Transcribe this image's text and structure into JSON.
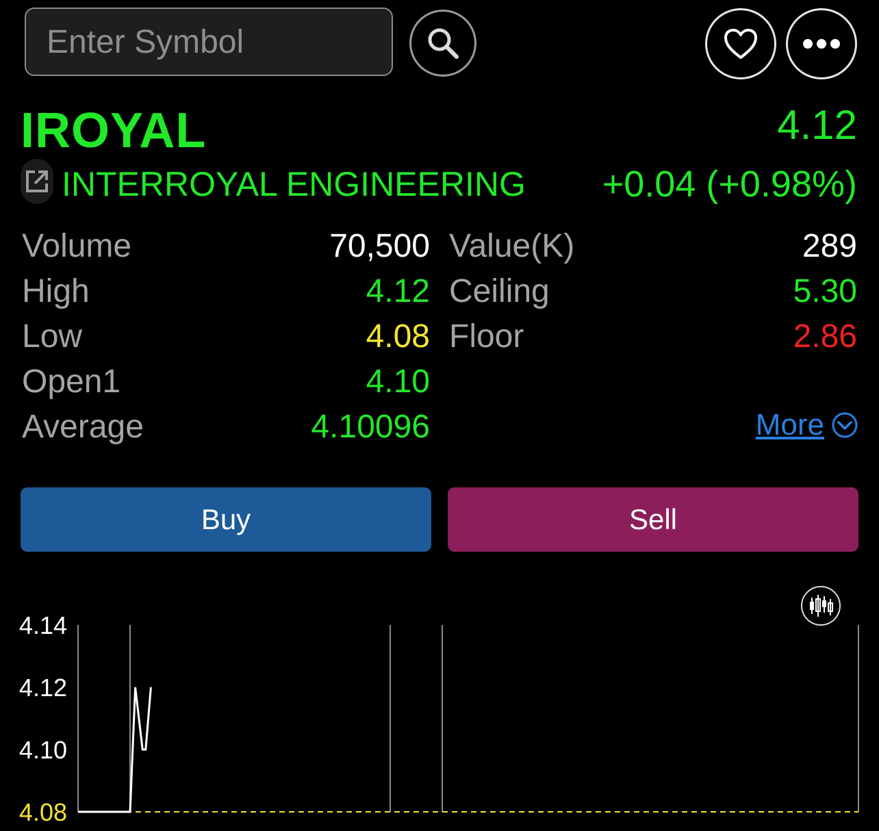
{
  "search": {
    "placeholder": "Enter Symbol"
  },
  "icons": {
    "search": "search-icon",
    "favorite": "heart-icon",
    "more": "ellipsis-icon",
    "external": "external-link-icon",
    "chart_type": "candlestick-icon",
    "chevron": "chevron-down-circle-icon"
  },
  "header": {
    "symbol": "IROYAL",
    "company": "INTERROYAL ENGINEERING",
    "price": "4.12",
    "change": "+0.04 (+0.98%)"
  },
  "stats": {
    "volume_label": "Volume",
    "volume": "70,500",
    "value_label": "Value(K)",
    "value": "289",
    "high_label": "High",
    "high": "4.12",
    "ceiling_label": "Ceiling",
    "ceiling": "5.30",
    "low_label": "Low",
    "low": "4.08",
    "floor_label": "Floor",
    "floor": "2.86",
    "open_label": "Open1",
    "open": "4.10",
    "average_label": "Average",
    "average": "4.10096",
    "more_label": "More"
  },
  "actions": {
    "buy": "Buy",
    "sell": "Sell"
  },
  "colors": {
    "up": "#22e82a",
    "down": "#f02020",
    "ref": "#f5e532",
    "buy": "#1e5a97",
    "sell": "#8c1f5b",
    "link": "#2a7fe0"
  },
  "chart_data": {
    "type": "line",
    "y_ticks": [
      "4.14",
      "4.12",
      "4.10",
      "4.08"
    ],
    "ylim": [
      4.08,
      4.14
    ],
    "xlim": [
      9.5,
      17
    ],
    "reference_line": 4.08,
    "session_breaks": [
      10,
      12.5,
      13
    ],
    "series": [
      {
        "x": [
          9.5,
          9.98,
          10.0,
          10.05,
          10.12,
          10.15,
          10.2
        ],
        "y": [
          4.08,
          4.08,
          4.08,
          4.12,
          4.1,
          4.1,
          4.12
        ]
      }
    ]
  }
}
